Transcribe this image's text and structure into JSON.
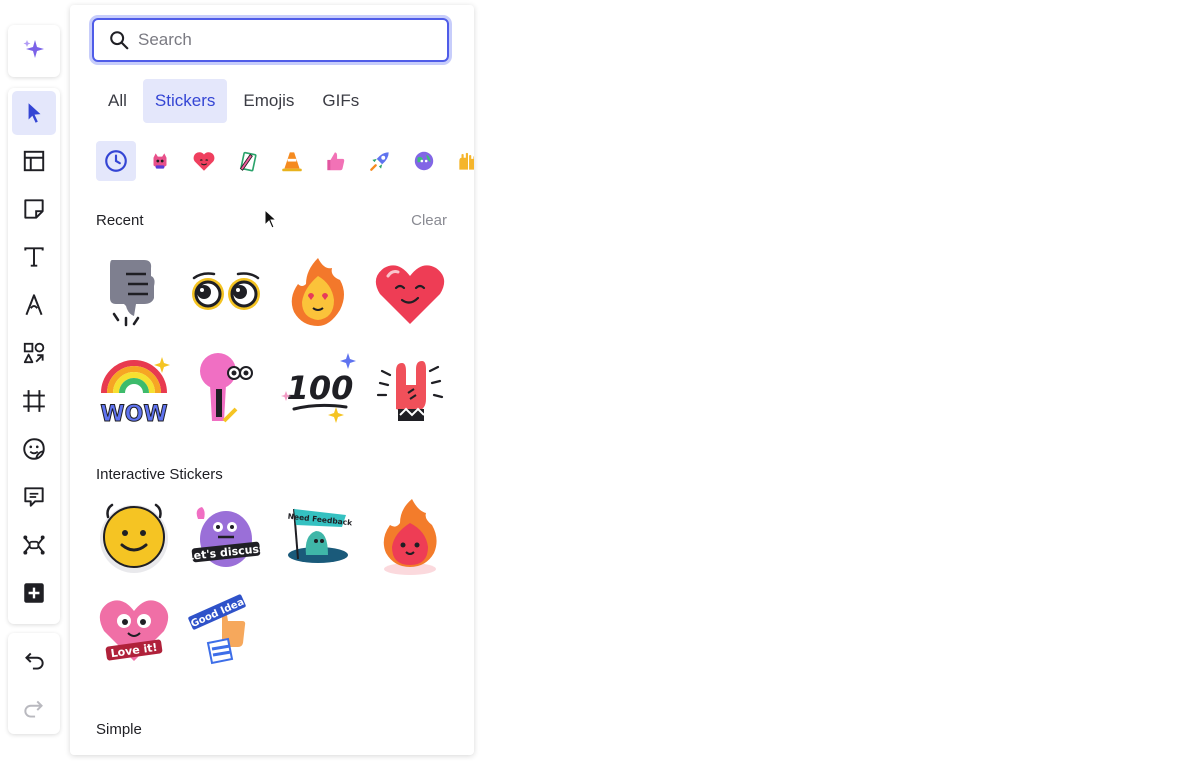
{
  "search": {
    "placeholder": "Search",
    "value": ""
  },
  "tabs": [
    {
      "label": "All",
      "active": false
    },
    {
      "label": "Stickers",
      "active": true
    },
    {
      "label": "Emojis",
      "active": false
    },
    {
      "label": "GIFs",
      "active": false
    }
  ],
  "categories": [
    "clock-icon",
    "heart-cat-icon",
    "smiley-heart-icon",
    "pencil-icon",
    "traffic-cone-icon",
    "thumbs-up-icon",
    "rocket-icon",
    "globe-face-icon",
    "hands-icon"
  ],
  "recent": {
    "title": "Recent",
    "clear_label": "Clear",
    "stickers": [
      "thumbs-down-sticker",
      "googly-eyes-sticker",
      "fire-love-sticker",
      "heart-smile-sticker",
      "rainbow-wow-sticker",
      "skeleton-keyhole-sticker",
      "hundred-sticker",
      "rock-hand-sticker"
    ]
  },
  "interactive": {
    "title": "Interactive Stickers",
    "stickers": [
      {
        "name": "smile-face-sticker"
      },
      {
        "name": "lets-discuss-sticker",
        "text": "Let's discuss"
      },
      {
        "name": "need-feedback-sticker",
        "text": "Need Feedback"
      },
      {
        "name": "fire-character-sticker"
      },
      {
        "name": "love-it-sticker",
        "text": "Love it!"
      },
      {
        "name": "good-idea-sticker",
        "text": "Good Idea"
      }
    ]
  },
  "simple": {
    "title": "Simple"
  },
  "colors": {
    "accent": "#4f5ce8",
    "active_bg": "#e4e7fb"
  }
}
